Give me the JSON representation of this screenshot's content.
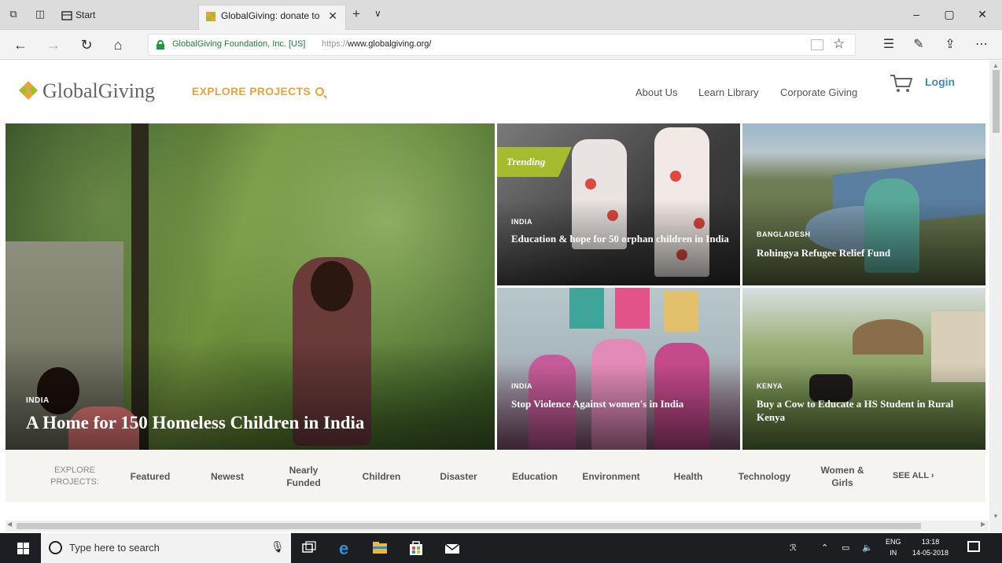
{
  "browser": {
    "tabs": [
      {
        "label": "Start"
      },
      {
        "label": "GlobalGiving: donate to"
      }
    ],
    "address": {
      "cert": "GlobalGiving Foundation, Inc. [US]",
      "url_scheme": "https://",
      "url_host": "www.globalgiving.org/"
    }
  },
  "site": {
    "logo_text": "GlobalGiving",
    "explore_label": "EXPLORE PROJECTS",
    "nav": [
      "About Us",
      "Learn Library",
      "Corporate Giving"
    ],
    "login_label": "Login",
    "accent_color": "#e8a33c",
    "link_color": "#3a8fb7"
  },
  "hero": {
    "country": "INDIA",
    "title": "A Home for 150 Homeless Children in India"
  },
  "tiles": [
    {
      "badge": "Trending",
      "country": "INDIA",
      "title": "Education & hope for 50 orphan children in India"
    },
    {
      "country": "BANGLADESH",
      "title": "Rohingya Refugee Relief Fund"
    },
    {
      "country": "INDIA",
      "title": "Stop Violence Against women's in India"
    },
    {
      "country": "KENYA",
      "title": "Buy a Cow to Educate a HS Student in Rural Kenya"
    }
  ],
  "categories": {
    "label": "EXPLORE PROJECTS:",
    "items": [
      "Featured",
      "Newest",
      "Nearly Funded",
      "Children",
      "Disaster",
      "Education",
      "Environment",
      "Health",
      "Technology",
      "Women & Girls"
    ],
    "see_all": "SEE ALL ›"
  },
  "taskbar": {
    "search_placeholder": "Type here to search",
    "lang_top": "ENG",
    "lang_bottom": "IN",
    "time": "13:18",
    "date": "14-05-2018"
  }
}
